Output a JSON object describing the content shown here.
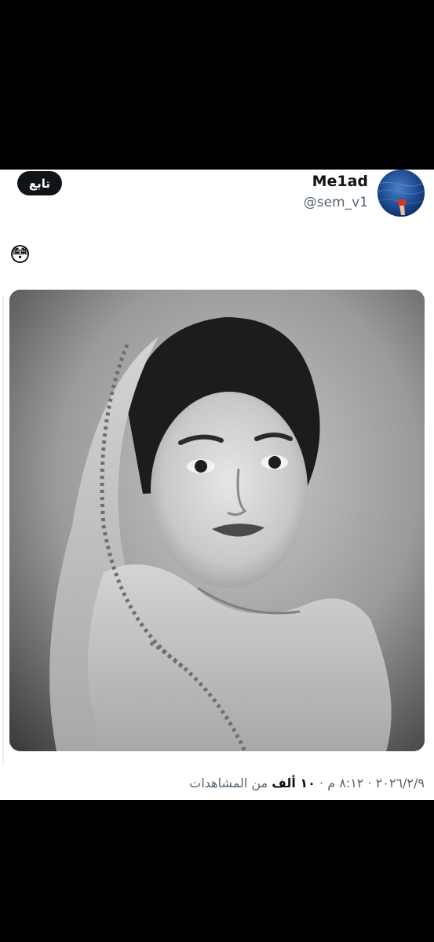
{
  "tweet": {
    "author": {
      "display_name": "Me1ad",
      "handle": "@sem_v1",
      "avatar_icon": "avatar-ocean-photo"
    },
    "follow_label": "تابع",
    "text": "😳",
    "media": {
      "kind": "black-and-white portrait photo",
      "icon": "photo-icon"
    },
    "meta": {
      "date": "٢٠٢٦/٢/٩",
      "separator": "·",
      "time": "٨:١٢ م",
      "views_count": "١٠ ألف",
      "views_label": "من المشاهدات"
    }
  },
  "colors": {
    "background": "#000000",
    "card": "#ffffff",
    "primary_text": "#0f1419",
    "secondary_text": "#536471",
    "follow_button": "#0f1419"
  }
}
